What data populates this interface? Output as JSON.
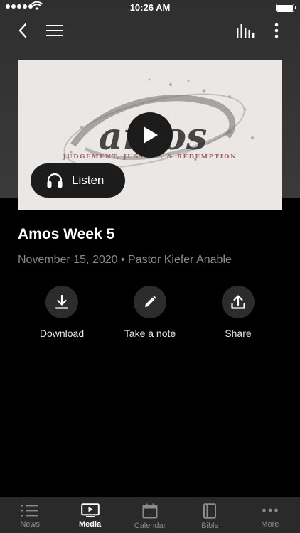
{
  "status_bar": {
    "time": "10:26 AM"
  },
  "media": {
    "artwork_title": "amos",
    "artwork_subtitle": "JUDGEMENT, JUSTICE, & REDEMPTION",
    "listen_label": "Listen"
  },
  "sermon": {
    "title": "Amos Week 5",
    "meta": "November 15, 2020 • Pastor Kiefer Anable"
  },
  "actions": [
    {
      "label": "Download",
      "icon": "download-icon"
    },
    {
      "label": "Take a note",
      "icon": "pencil-icon"
    },
    {
      "label": "Share",
      "icon": "share-icon"
    }
  ],
  "tabbar": {
    "items": [
      {
        "label": "News",
        "icon": "list-icon",
        "active": false
      },
      {
        "label": "Media",
        "icon": "play-screen-icon",
        "active": true
      },
      {
        "label": "Calendar",
        "icon": "calendar-icon",
        "active": false
      },
      {
        "label": "Bible",
        "icon": "book-icon",
        "active": false
      },
      {
        "label": "More",
        "icon": "ellipsis-icon",
        "active": false
      }
    ]
  },
  "colors": {
    "background": "#000000",
    "header": "#333333",
    "tabbar": "#2a2a2a",
    "muted_text": "#8a8a8a",
    "artwork_accent": "#a55f65"
  }
}
